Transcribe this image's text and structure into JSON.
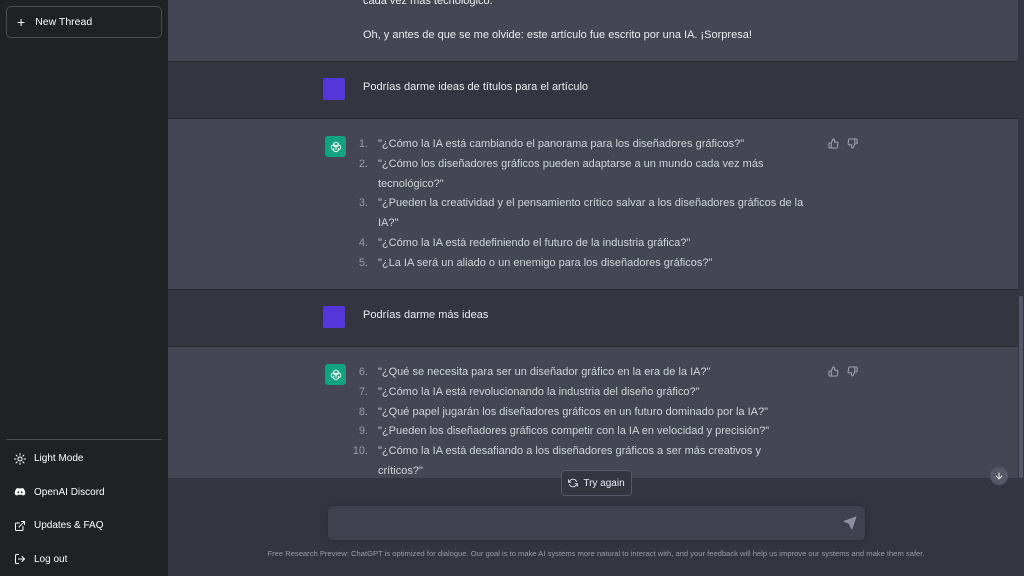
{
  "sidebar": {
    "new_thread": "New Thread",
    "items": [
      {
        "label": "Light Mode",
        "icon": "sun-icon"
      },
      {
        "label": "OpenAI Discord",
        "icon": "discord-icon"
      },
      {
        "label": "Updates & FAQ",
        "icon": "external-link-icon"
      },
      {
        "label": "Log out",
        "icon": "logout-icon"
      }
    ]
  },
  "conversation": {
    "top_partial_line": "cada vez más tecnológico.",
    "top_last_line": "Oh, y antes de que se me olvide: este artículo fue escrito por una IA. ¡Sorpresa!",
    "user_msg_1": "Podrías darme ideas de títulos para el artículo",
    "reply_1": [
      {
        "num": "1.",
        "text": "\"¿Cómo la IA está cambiando el panorama para los diseñadores gráficos?\""
      },
      {
        "num": "2.",
        "text": "\"¿Cómo los diseñadores gráficos pueden adaptarse a un mundo cada vez más tecnológico?\""
      },
      {
        "num": "3.",
        "text": "\"¿Pueden la creatividad y el pensamiento crítico salvar a los diseñadores gráficos de la IA?\""
      },
      {
        "num": "4.",
        "text": "\"¿Cómo la IA está redefiniendo el futuro de la industria gráfica?\""
      },
      {
        "num": "5.",
        "text": "\"¿La IA será un aliado o un enemigo para los diseñadores gráficos?\""
      }
    ],
    "user_msg_2": "Podrías darme más ideas",
    "reply_2": [
      {
        "num": "6.",
        "text": "\"¿Qué se necesita para ser un diseñador gráfico en la era de la IA?\""
      },
      {
        "num": "7.",
        "text": "\"¿Cómo la IA está revolucionando la industria del diseño gráfico?\""
      },
      {
        "num": "8.",
        "text": "\"¿Qué papel jugarán los diseñadores gráficos en un futuro dominado por la IA?\""
      },
      {
        "num": "9.",
        "text": "\"¿Pueden los diseñadores gráficos competir con la IA en velocidad y precisión?\""
      },
      {
        "num": "10.",
        "text": "\"¿Cómo la IA está desafiando a los diseñadores gráficos a ser más creativos y críticos?\""
      }
    ]
  },
  "controls": {
    "try_again": "Try again",
    "input_value": "",
    "input_placeholder": ""
  },
  "footer": "Free Research Preview: ChatGPT is optimized for dialogue. Our goal is to make AI systems more natural to interact with, and your feedback will help us improve our systems and make them safer.",
  "colors": {
    "sidebar_bg": "#202123",
    "main_bg": "#343541",
    "bot_row_bg": "#444654",
    "user_avatar": "#5436da",
    "bot_avatar": "#10a37f"
  }
}
